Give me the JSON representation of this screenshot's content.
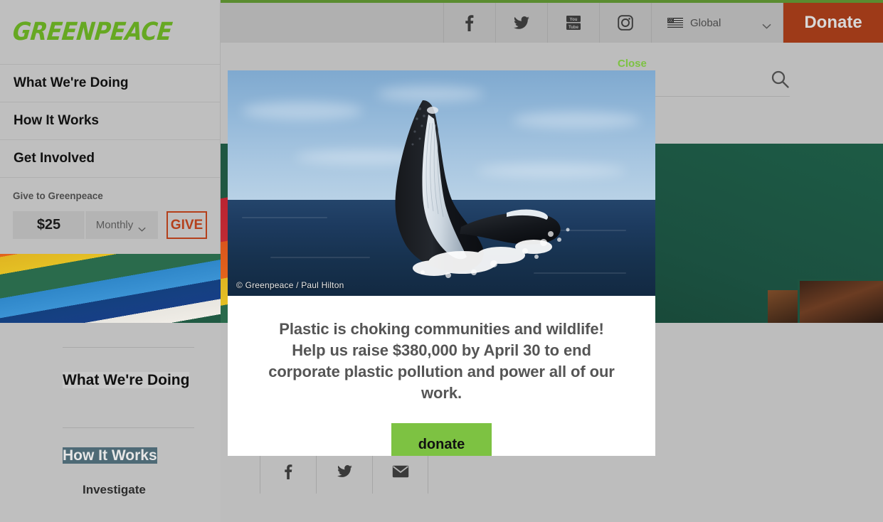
{
  "brand": {
    "logo_text": "GREENPEACE",
    "logo_color": "#66a822"
  },
  "utility_bar": {
    "social": [
      {
        "name": "facebook-icon",
        "label": "Facebook"
      },
      {
        "name": "twitter-icon",
        "label": "Twitter"
      },
      {
        "name": "youtube-icon",
        "label": "YouTube"
      },
      {
        "name": "instagram-icon",
        "label": "Instagram"
      }
    ],
    "language": {
      "label": "Global",
      "flag": "us-flag-icon",
      "chevron": "chevron-down-icon"
    },
    "donate_label": "Donate",
    "donate_color": "#9e3a18"
  },
  "search": {
    "icon": "search-icon",
    "value": "",
    "placeholder": ""
  },
  "sidebar": {
    "nav_items": [
      {
        "label": "What We're Doing"
      },
      {
        "label": "How It Works"
      },
      {
        "label": "Get Involved"
      }
    ],
    "give": {
      "heading": "Give to Greenpeace",
      "amount": "$25",
      "frequency": "Monthly",
      "frequency_chevron": "chevron-down-icon",
      "button_label": "GIVE",
      "button_color": "#b4401b"
    },
    "lower_links": {
      "what_were_doing": "What We're Doing",
      "how_it_works": "How It Works",
      "investigate": "Investigate"
    }
  },
  "hero": {
    "alt": "Rainbow Warrior ship hull with dove and rainbow stripes"
  },
  "article_share": [
    {
      "name": "facebook-share-icon",
      "label": "Share on Facebook"
    },
    {
      "name": "twitter-share-icon",
      "label": "Share on Twitter"
    },
    {
      "name": "email-share-icon",
      "label": "Share by Email"
    }
  ],
  "modal": {
    "close_label": "Close",
    "close_color": "#7dc242",
    "photo_credit": "© Greenpeace / Paul Hilton",
    "photo_alt": "Breaching humpback whale",
    "copy": "Plastic is choking communities and wildlife! Help us raise $380,000 by April 30 to end corporate plastic pollution and power all of our work.",
    "cta_label": "donate",
    "cta_color": "#7dc242"
  }
}
